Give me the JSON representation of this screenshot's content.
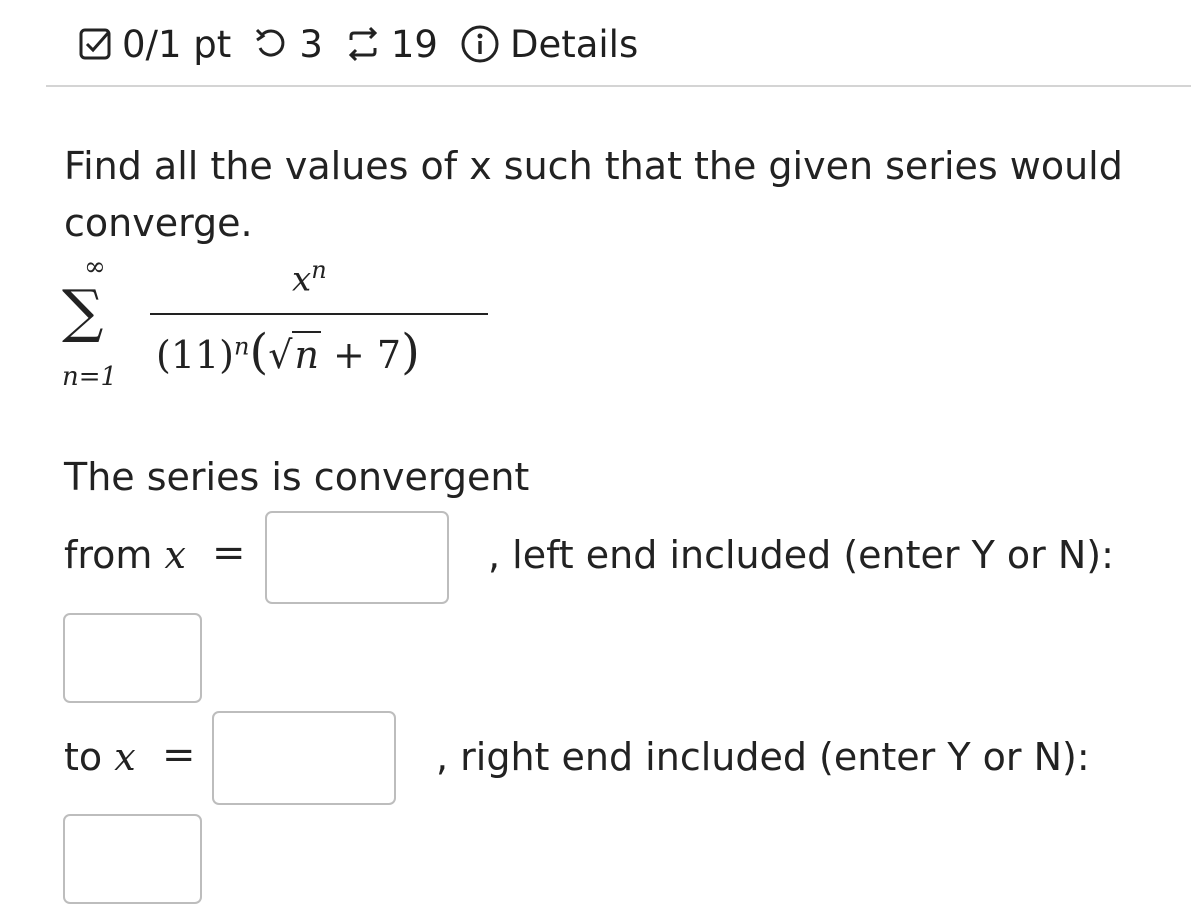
{
  "header": {
    "score": "0/1 pt",
    "retries": "3",
    "attempts": "19",
    "details": "Details",
    "icons": [
      "checkbox-icon",
      "retry-icon",
      "repeat-icon",
      "info-icon"
    ]
  },
  "question": {
    "prompt": "Find all the values of x such that the given series would converge.",
    "series": {
      "lower_limit": "n=1",
      "upper_limit": "∞",
      "numerator_base": "x",
      "numerator_exp": "n",
      "denominator_base": "(11)",
      "denominator_exp": "n",
      "sqrt_arg": "n",
      "plus": "+ 7"
    }
  },
  "answer": {
    "intro": "The series is convergent",
    "from_label": "from",
    "to_label": "to",
    "var": "x",
    "equals": "=",
    "left_end_text": ", left end included (enter Y or N):",
    "right_end_text": ", right end included (enter Y or N):",
    "from_value": "",
    "left_included_value": "",
    "to_value": "",
    "right_included_value": ""
  }
}
